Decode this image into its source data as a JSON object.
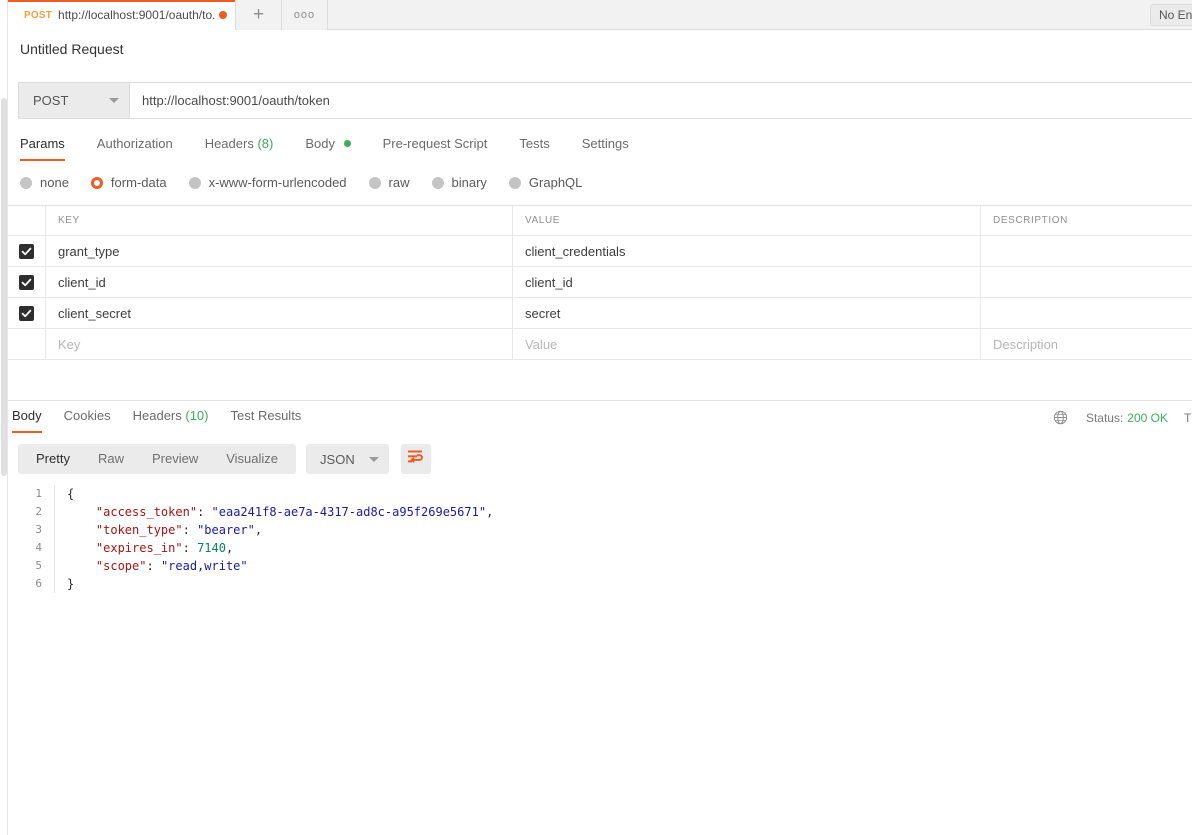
{
  "tabbar": {
    "tab": {
      "method": "POST",
      "url": "http://localhost:9001/oauth/to...",
      "unsaved_dot": true
    },
    "new_tab_label": "+",
    "more_label": "ooo",
    "environment_selector": "No Environment"
  },
  "request": {
    "title": "Untitled Request",
    "method": "POST",
    "url": "http://localhost:9001/oauth/token",
    "tabs": [
      {
        "label": "Params",
        "active": false
      },
      {
        "label": "Authorization",
        "active": false
      },
      {
        "label": "Headers",
        "count": "(8)",
        "active": false
      },
      {
        "label": "Body",
        "active": true,
        "dot": true
      },
      {
        "label": "Pre-request Script",
        "active": false
      },
      {
        "label": "Tests",
        "active": false
      },
      {
        "label": "Settings",
        "active": false
      }
    ],
    "body_types": [
      {
        "label": "none",
        "selected": false
      },
      {
        "label": "form-data",
        "selected": true
      },
      {
        "label": "x-www-form-urlencoded",
        "selected": false
      },
      {
        "label": "raw",
        "selected": false
      },
      {
        "label": "binary",
        "selected": false
      },
      {
        "label": "GraphQL",
        "selected": false
      }
    ],
    "table": {
      "headers": {
        "key": "KEY",
        "value": "VALUE",
        "description": "DESCRIPTION"
      },
      "rows": [
        {
          "checked": true,
          "key": "grant_type",
          "value": "client_credentials",
          "description": ""
        },
        {
          "checked": true,
          "key": "client_id",
          "value": "client_id",
          "description": ""
        },
        {
          "checked": true,
          "key": "client_secret",
          "value": "secret",
          "description": ""
        }
      ],
      "placeholder_row": {
        "key": "Key",
        "value": "Value",
        "description": "Description"
      }
    }
  },
  "response": {
    "tabs": [
      {
        "label": "Body",
        "active": true
      },
      {
        "label": "Cookies",
        "active": false
      },
      {
        "label": "Headers",
        "count": "(10)",
        "active": false
      },
      {
        "label": "Test Results",
        "active": false
      }
    ],
    "status_label": "Status:",
    "status_value": "200 OK",
    "time_clipped": "T",
    "viewer": {
      "modes": [
        {
          "label": "Pretty",
          "active": true
        },
        {
          "label": "Raw",
          "active": false
        },
        {
          "label": "Preview",
          "active": false
        },
        {
          "label": "Visualize",
          "active": false
        }
      ],
      "format": "JSON"
    },
    "body_lines": [
      {
        "n": "1",
        "parts": [
          {
            "t": "{",
            "c": "k-punc"
          }
        ]
      },
      {
        "n": "2",
        "parts": [
          {
            "t": "    ",
            "c": "k-punc"
          },
          {
            "t": "\"access_token\"",
            "c": "k-key"
          },
          {
            "t": ": ",
            "c": "k-punc"
          },
          {
            "t": "\"eaa241f8-ae7a-4317-ad8c-a95f269e5671\"",
            "c": "k-str"
          },
          {
            "t": ",",
            "c": "k-punc"
          }
        ]
      },
      {
        "n": "3",
        "parts": [
          {
            "t": "    ",
            "c": "k-punc"
          },
          {
            "t": "\"token_type\"",
            "c": "k-key"
          },
          {
            "t": ": ",
            "c": "k-punc"
          },
          {
            "t": "\"bearer\"",
            "c": "k-str"
          },
          {
            "t": ",",
            "c": "k-punc"
          }
        ]
      },
      {
        "n": "4",
        "parts": [
          {
            "t": "    ",
            "c": "k-punc"
          },
          {
            "t": "\"expires_in\"",
            "c": "k-key"
          },
          {
            "t": ": ",
            "c": "k-punc"
          },
          {
            "t": "7140",
            "c": "k-num"
          },
          {
            "t": ",",
            "c": "k-punc"
          }
        ]
      },
      {
        "n": "5",
        "parts": [
          {
            "t": "    ",
            "c": "k-punc"
          },
          {
            "t": "\"scope\"",
            "c": "k-key"
          },
          {
            "t": ": ",
            "c": "k-punc"
          },
          {
            "t": "\"read,write\"",
            "c": "k-str"
          }
        ]
      },
      {
        "n": "6",
        "parts": [
          {
            "t": "}",
            "c": "k-punc"
          }
        ]
      }
    ],
    "json_values": {
      "access_token": "eaa241f8-ae7a-4317-ad8c-a95f269e5671",
      "token_type": "bearer",
      "expires_in": 7140,
      "scope": "read,write"
    }
  },
  "colors": {
    "accent": "#ef5b25",
    "success": "#3dac5b",
    "method": "#e8a33d",
    "toolbar_bg": "#ebebeb"
  }
}
